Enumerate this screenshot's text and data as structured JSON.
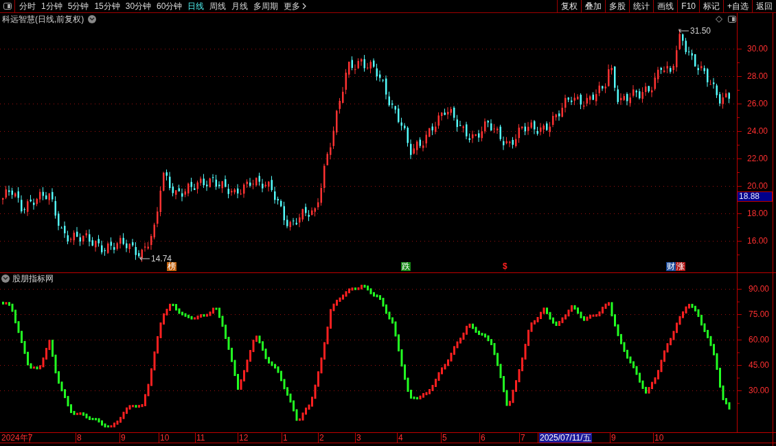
{
  "toolbar": {
    "periods": [
      {
        "label": "分时",
        "selected": false
      },
      {
        "label": "1分钟",
        "selected": false
      },
      {
        "label": "5分钟",
        "selected": false
      },
      {
        "label": "15分钟",
        "selected": false
      },
      {
        "label": "30分钟",
        "selected": false
      },
      {
        "label": "60分钟",
        "selected": false
      },
      {
        "label": "日线",
        "selected": true
      },
      {
        "label": "周线",
        "selected": false
      },
      {
        "label": "月线",
        "selected": false
      },
      {
        "label": "多周期",
        "selected": false
      },
      {
        "label": "更多",
        "selected": false
      }
    ],
    "actions": [
      "复权",
      "叠加",
      "多股",
      "统计",
      "画线",
      "F10",
      "标记",
      "+自选",
      "返回"
    ]
  },
  "price_chart": {
    "title": "科远智慧(日线,前复权)",
    "y_ticks": [
      "30.00",
      "28.00",
      "26.00",
      "24.00",
      "22.00",
      "20.00",
      "18.00",
      "16.00"
    ],
    "current_price": "18.88",
    "high_label": "31.50",
    "low_label": "14.74",
    "markers": [
      {
        "text": "榜",
        "kind": "badge",
        "color": "#c0600c"
      },
      {
        "text": "跌",
        "kind": "badge",
        "color": "#168a16"
      },
      {
        "text": "$",
        "kind": "glyph",
        "color": "#ff2020"
      },
      {
        "text": "财",
        "kind": "badge",
        "color": "#1a4a9a"
      },
      {
        "text": "涨",
        "kind": "badge",
        "color": "#b01818"
      }
    ]
  },
  "indicator": {
    "title": "股朋指标网",
    "y_ticks": [
      "90.00",
      "75.00",
      "60.00",
      "45.00",
      "30.00"
    ]
  },
  "date_axis": {
    "labels": [
      {
        "text": "2024年7",
        "selected": false
      },
      {
        "text": "8",
        "selected": false
      },
      {
        "text": "9",
        "selected": false
      },
      {
        "text": "10",
        "selected": false
      },
      {
        "text": "11",
        "selected": false
      },
      {
        "text": "12",
        "selected": false
      },
      {
        "text": "1",
        "selected": false
      },
      {
        "text": "2",
        "selected": false
      },
      {
        "text": "3",
        "selected": false
      },
      {
        "text": "4",
        "selected": false
      },
      {
        "text": "5",
        "selected": false
      },
      {
        "text": "6",
        "selected": false
      },
      {
        "text": "7",
        "selected": false
      },
      {
        "text": "2025/07/11/五",
        "selected": true
      },
      {
        "text": "9",
        "selected": false
      },
      {
        "text": "10",
        "selected": false
      }
    ]
  }
}
